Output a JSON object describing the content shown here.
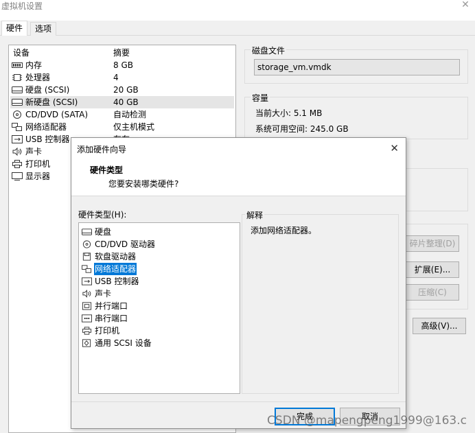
{
  "window": {
    "title": "虚拟机设置",
    "close_glyph": "✕"
  },
  "tabs": [
    {
      "label": "硬件"
    },
    {
      "label": "选项"
    }
  ],
  "device_list": {
    "header_device": "设备",
    "header_summary": "摘要",
    "rows": [
      {
        "name": "内存",
        "summary": "8 GB",
        "icon": "memory-icon"
      },
      {
        "name": "处理器",
        "summary": "4",
        "icon": "processor-icon"
      },
      {
        "name": "硬盘 (SCSI)",
        "summary": "20 GB",
        "icon": "hard-disk-icon"
      },
      {
        "name": "新硬盘 (SCSI)",
        "summary": "40 GB",
        "icon": "hard-disk-icon",
        "selected": true
      },
      {
        "name": "CD/DVD (SATA)",
        "summary": "自动检测",
        "icon": "cd-dvd-icon"
      },
      {
        "name": "网络适配器",
        "summary": "仅主机模式",
        "icon": "network-adapter-icon"
      },
      {
        "name": "USB 控制器",
        "summary": "存在",
        "icon": "usb-controller-icon"
      },
      {
        "name": "声卡",
        "summary": "",
        "icon": "sound-card-icon"
      },
      {
        "name": "打印机",
        "summary": "",
        "icon": "printer-icon"
      },
      {
        "name": "显示器",
        "summary": "",
        "icon": "display-icon"
      }
    ]
  },
  "disk_file": {
    "label": "磁盘文件",
    "value": "storage_vm.vmdk"
  },
  "capacity": {
    "label": "容量",
    "current_size": "当前大小: 5.1 MB",
    "available_space": "系统可用空间: 245.0 GB"
  },
  "buttons": {
    "defragment": "碎片整理(D)",
    "expand": "扩展(E)...",
    "compact": "压缩(C)",
    "advanced": "高级(V)..."
  },
  "wizard": {
    "title": "添加硬件向导",
    "close_glyph": "✕",
    "heading": "硬件类型",
    "subheading": "您要安装哪类硬件?",
    "list_label": "硬件类型(H):",
    "items": [
      {
        "name": "硬盘",
        "icon": "hard-disk-icon"
      },
      {
        "name": "CD/DVD 驱动器",
        "icon": "cd-dvd-icon"
      },
      {
        "name": "软盘驱动器",
        "icon": "floppy-icon"
      },
      {
        "name": "网络适配器",
        "icon": "network-adapter-icon",
        "selected": true
      },
      {
        "name": "USB 控制器",
        "icon": "usb-controller-icon"
      },
      {
        "name": "声卡",
        "icon": "sound-card-icon"
      },
      {
        "name": "并行端口",
        "icon": "parallel-port-icon"
      },
      {
        "name": "串行端口",
        "icon": "serial-port-icon"
      },
      {
        "name": "打印机",
        "icon": "printer-icon"
      },
      {
        "name": "通用 SCSI 设备",
        "icon": "scsi-device-icon"
      }
    ],
    "explain_label": "解释",
    "explain_text": "添加网络适配器。",
    "finish": "完成",
    "cancel": "取消"
  },
  "watermark": "CSDN @mapengpeng1999@163.c"
}
